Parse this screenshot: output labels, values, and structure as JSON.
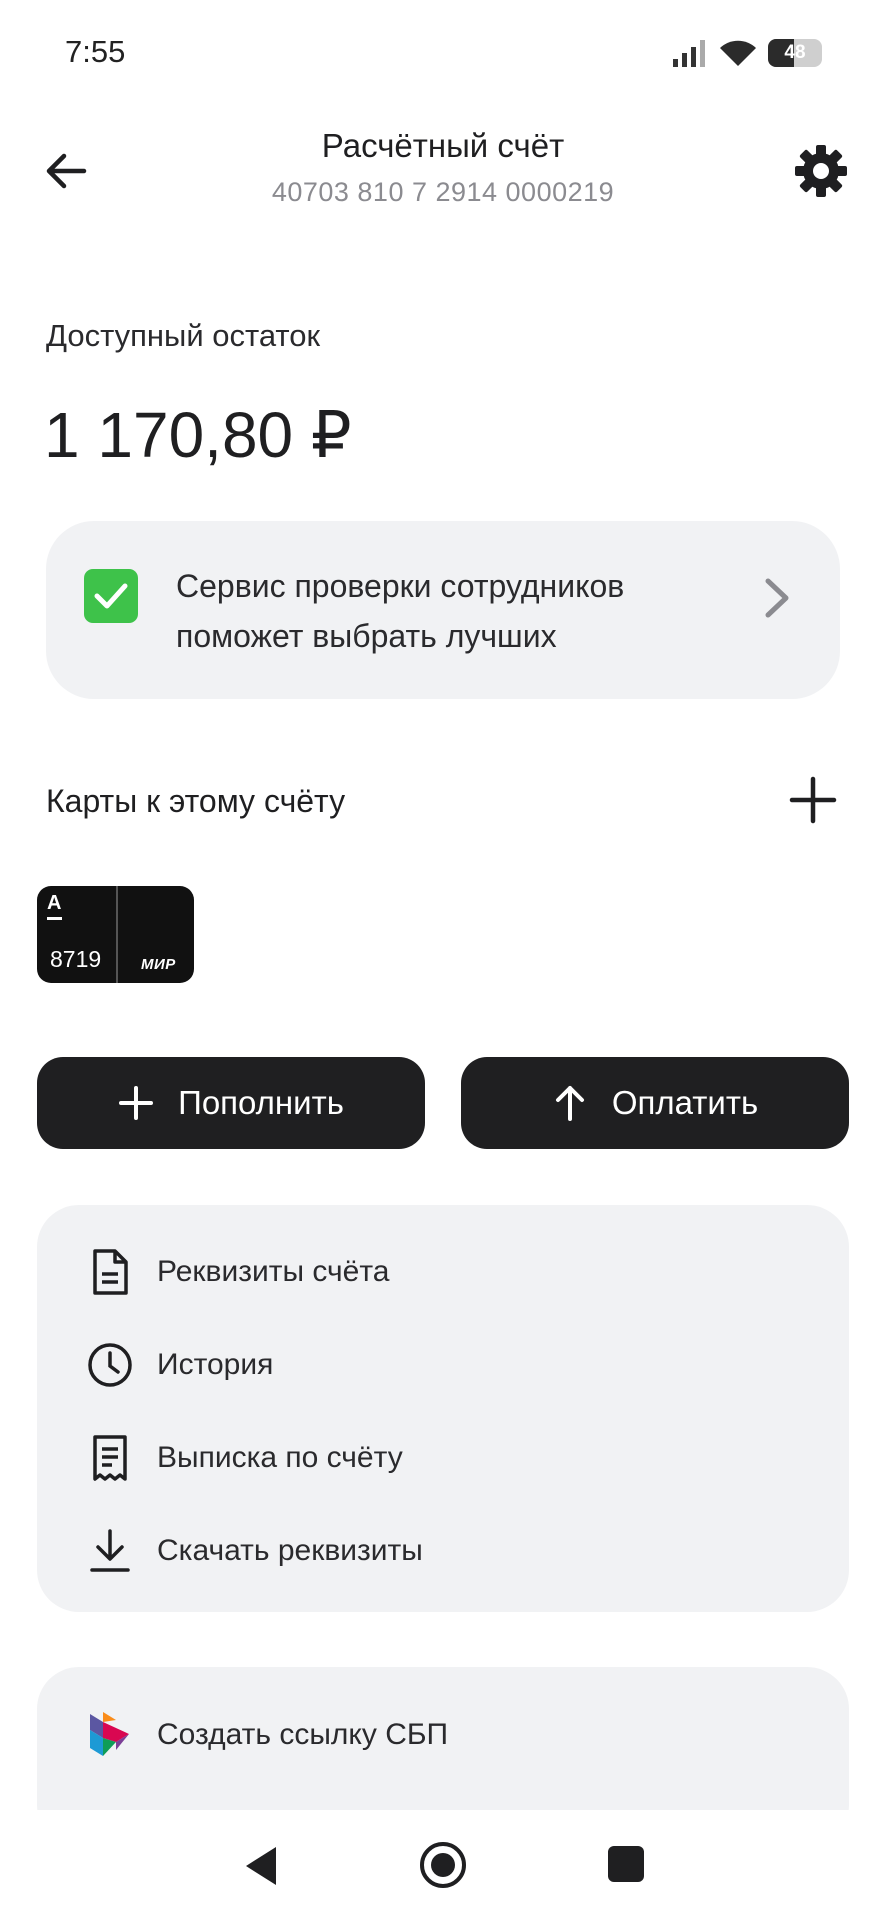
{
  "status_bar": {
    "time": "7:55",
    "battery": "48",
    "battery_level": 0.48
  },
  "header": {
    "title": "Расчётный счёт",
    "account_number": "40703 810 7 2914 0000219"
  },
  "balance": {
    "label": "Доступный остаток",
    "value": "1 170,80 ₽"
  },
  "promo": {
    "text": "Сервис проверки сотрудников поможет выбрать лучших"
  },
  "cards_section": {
    "title": "Карты к этому счёту",
    "cards": [
      {
        "bank_logo": "A",
        "last_digits": "8719",
        "payment_system": "МИР"
      }
    ]
  },
  "actions": {
    "topup_label": "Пополнить",
    "pay_label": "Оплатить"
  },
  "menu": {
    "items": [
      {
        "label": "Реквизиты счёта",
        "icon": "document-icon"
      },
      {
        "label": "История",
        "icon": "clock-icon"
      },
      {
        "label": "Выписка по счёту",
        "icon": "receipt-icon"
      },
      {
        "label": "Скачать реквизиты",
        "icon": "download-icon"
      }
    ]
  },
  "sbp": {
    "label": "Создать ссылку СБП",
    "icon": "sbp-logo-icon"
  },
  "colors": {
    "accent_dark": "#1f1f21",
    "panel_bg": "#f1f2f4",
    "check_green": "#3ec24a"
  }
}
